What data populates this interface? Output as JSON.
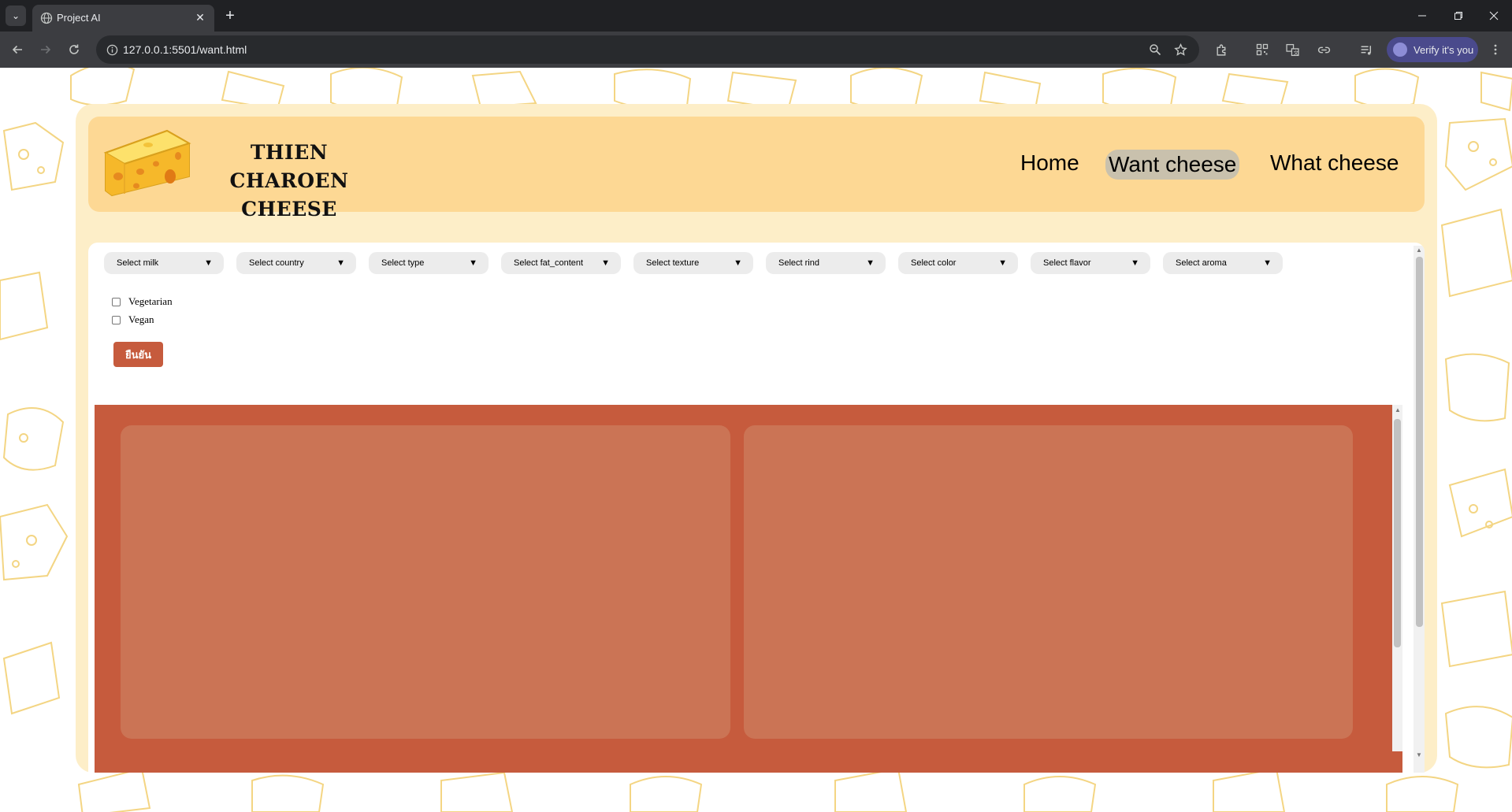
{
  "browser": {
    "tab_title": "Project AI",
    "url": "127.0.0.1:5501/want.html",
    "verify_label": "Verify it's you"
  },
  "header": {
    "brand_line1": "THIEN CHAROEN",
    "brand_line2": "CHEESE",
    "nav": {
      "home": "Home",
      "want": "Want cheese",
      "what": "What cheese"
    }
  },
  "filters": {
    "dropdowns": [
      "Select milk",
      "Select country",
      "Select type",
      "Select fat_content",
      "Select texture",
      "Select rind",
      "Select color",
      "Select flavor",
      "Select aroma"
    ],
    "checkboxes": {
      "vegetarian": "Vegetarian",
      "vegan": "Vegan"
    },
    "confirm_label": "ยืนยัน"
  },
  "colors": {
    "header_bg": "#fdd894",
    "card_bg": "#fdeec8",
    "accent": "#c65b3d",
    "result_card": "#cb7455",
    "active_nav": "#c9c1ad"
  },
  "icons": [
    "tab-list-icon",
    "globe-icon",
    "close-icon",
    "plus-icon",
    "back-icon",
    "forward-icon",
    "reload-icon",
    "info-icon",
    "zoom-icon",
    "star-icon",
    "extension-icon",
    "qr-icon",
    "translate-icon",
    "link-icon",
    "media-icon",
    "menu-icon",
    "cheese-logo"
  ]
}
